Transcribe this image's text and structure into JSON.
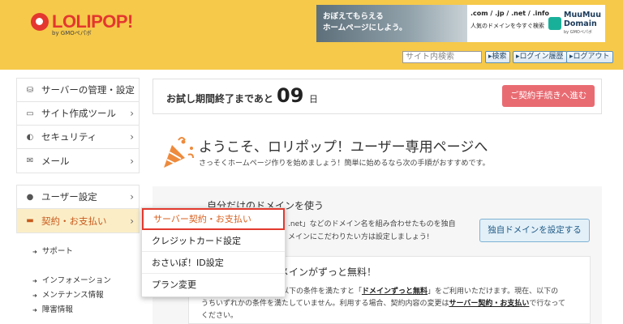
{
  "header": {
    "logo_text": "LOLIPOP!",
    "logo_sub": "by GMOペパボ",
    "banner": {
      "photo_line1": "おぼえてもらえる",
      "photo_line2": "ホームページにしよう。",
      "mid_line1": ".com / .jp / .net / .info",
      "mid_line2": "人気のドメインを今すぐ検索",
      "brand_line1": "MuuMuu",
      "brand_line2": "Domain",
      "brand_sub": "by GMOペパボ"
    },
    "search_placeholder": "サイト内検索",
    "search_button": "▸検索",
    "login_history_button": "▸ログイン履歴",
    "logout_button": "▸ログアウト"
  },
  "sidebar": {
    "group1": [
      {
        "icon": "server-icon",
        "glyph": "⛁",
        "label": "サーバーの管理・設定"
      },
      {
        "icon": "laptop-icon",
        "glyph": "▭",
        "label": "サイト作成ツール"
      },
      {
        "icon": "shield-icon",
        "glyph": "◐",
        "label": "セキュリティ"
      },
      {
        "icon": "mail-icon",
        "glyph": "✉",
        "label": "メール"
      }
    ],
    "group2": [
      {
        "icon": "user-icon",
        "glyph": "●",
        "label": "ユーザー設定"
      },
      {
        "icon": "card-icon",
        "glyph": "▬",
        "label": "契約・お支払い"
      }
    ],
    "chevron": "›",
    "support": "サポート",
    "info_links": [
      "インフォメーション",
      "メンテナンス情報",
      "障害情報"
    ]
  },
  "trial": {
    "label": "お試し期間終了まであと",
    "days": "09",
    "unit": "日",
    "button": "ご契約手続きへ進む"
  },
  "welcome": {
    "title": "ようこそ、ロリポップ！ユーザー専用ページへ",
    "subtitle": "さっそくホームページ作りを始めましょう！簡単に始めるなら次の手順がおすすめです。"
  },
  "domain_card": {
    "title": "自分だけのドメインを使う",
    "text1": ".net」などのドメイン名を組み合わせたものを独自",
    "text2": "メインにこだわりたい方は設定しましょう!",
    "button": "独自ドメインを設定する"
  },
  "free_card": {
    "title": "メインがずっと無料！",
    "line1_pre": "に以下の条件を満たすと「",
    "line1_bold": "ドメインずっと無料",
    "line1_post": "」をご利用いただけます。現在、以下の",
    "line2_pre": "うちいずれかの条件を満たしていません。利用する場合、契約内容の変更は",
    "line2_bold": "サーバー契約・お支払い",
    "line2_post": "で行なって",
    "line3": "ください。"
  },
  "dropdown": {
    "items": [
      "サーバー契約・お支払い",
      "クレジットカード設定",
      "おさいぽ！ID設定",
      "プラン変更"
    ]
  },
  "colors": {
    "header_bg": "#f6c94a",
    "brand_red": "#e4372f",
    "active_menu_bg": "#fbeec7",
    "contract_button": "#e96b72",
    "highlight_border": "#e23a2e"
  }
}
